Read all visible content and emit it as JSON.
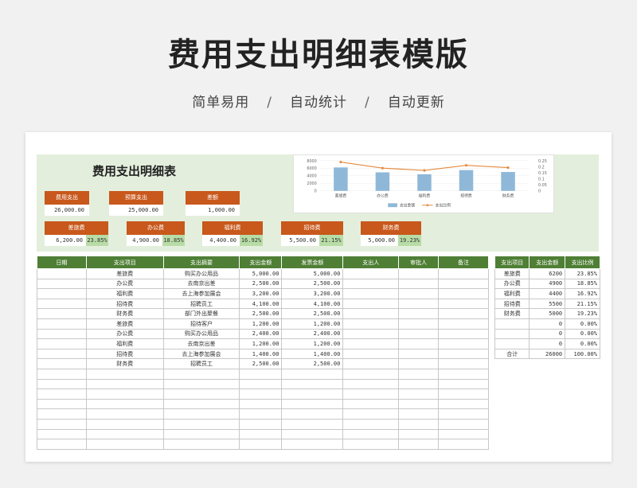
{
  "hero": {
    "title": "费用支出明细表模版",
    "subtitle_items": [
      "简单易用",
      "自动统计",
      "自动更新"
    ],
    "separator": "/"
  },
  "panel": {
    "title": "费用支出明细表",
    "kpis": [
      {
        "label": "费用支出",
        "value": "26,000.00"
      },
      {
        "label": "预算支出",
        "value": "25,000.00"
      },
      {
        "label": "差额",
        "value": "1,000.00"
      }
    ],
    "categories": [
      {
        "label": "差旅费",
        "value": "6,200.00",
        "pct": "23.85%"
      },
      {
        "label": "办公费",
        "value": "4,900.00",
        "pct": "18.85%"
      },
      {
        "label": "福利费",
        "value": "4,400.00",
        "pct": "16.92%"
      },
      {
        "label": "招待费",
        "value": "5,500.00",
        "pct": "21.15%"
      },
      {
        "label": "财务费",
        "value": "5,000.00",
        "pct": "19.23%"
      }
    ]
  },
  "chart_data": {
    "type": "bar",
    "categories": [
      "差旅费",
      "办公费",
      "福利费",
      "招待费",
      "财务费"
    ],
    "series": [
      {
        "name": "支出金额",
        "type": "bar",
        "values": [
          6200,
          4900,
          4400,
          5500,
          5000
        ],
        "axis": "left"
      },
      {
        "name": "支出比例",
        "type": "line",
        "values": [
          0.2385,
          0.1885,
          0.1692,
          0.2115,
          0.1923
        ],
        "axis": "right"
      }
    ],
    "y_ticks": [
      "8000",
      "6000",
      "4000",
      "2000",
      "0"
    ],
    "y2_ticks": [
      "0.25",
      "0.2",
      "0.15",
      "0.1",
      "0.05",
      "0"
    ],
    "ylim": [
      0,
      8000
    ],
    "y2lim": [
      0,
      0.25
    ],
    "legend_position": "bottom",
    "colors": {
      "bar": "#8fb8d8",
      "line": "#e58a3c"
    }
  },
  "main_table": {
    "headers": [
      "日期",
      "支出项目",
      "支出摘要",
      "支出金额",
      "发票金额",
      "支出人",
      "审批人",
      "备注"
    ],
    "rows": [
      [
        "",
        "差旅费",
        "购买办公用品",
        "5,000.00",
        "5,000.00",
        "",
        "",
        ""
      ],
      [
        "",
        "办公费",
        "去南京出差",
        "2,500.00",
        "2,500.00",
        "",
        "",
        ""
      ],
      [
        "",
        "福利费",
        "去上海参加展会",
        "3,200.00",
        "3,200.00",
        "",
        "",
        ""
      ],
      [
        "",
        "招待费",
        "招聘员工",
        "4,100.00",
        "4,100.00",
        "",
        "",
        ""
      ],
      [
        "",
        "财务费",
        "部门外出聚餐",
        "2,500.00",
        "2,500.00",
        "",
        "",
        ""
      ],
      [
        "",
        "差旅费",
        "招待客户",
        "1,200.00",
        "1,200.00",
        "",
        "",
        ""
      ],
      [
        "",
        "办公费",
        "购买办公用品",
        "2,400.00",
        "2,400.00",
        "",
        "",
        ""
      ],
      [
        "",
        "福利费",
        "去南京出差",
        "1,200.00",
        "1,200.00",
        "",
        "",
        ""
      ],
      [
        "",
        "招待费",
        "去上海参加展会",
        "1,400.00",
        "1,400.00",
        "",
        "",
        ""
      ],
      [
        "",
        "财务费",
        "招聘员工",
        "2,500.00",
        "2,500.00",
        "",
        "",
        ""
      ],
      [
        "",
        "",
        "",
        "",
        "",
        "",
        "",
        ""
      ],
      [
        "",
        "",
        "",
        "",
        "",
        "",
        "",
        ""
      ],
      [
        "",
        "",
        "",
        "",
        "",
        "",
        "",
        ""
      ],
      [
        "",
        "",
        "",
        "",
        "",
        "",
        "",
        ""
      ],
      [
        "",
        "",
        "",
        "",
        "",
        "",
        "",
        ""
      ],
      [
        "",
        "",
        "",
        "",
        "",
        "",
        "",
        ""
      ],
      [
        "",
        "",
        "",
        "",
        "",
        "",
        "",
        ""
      ],
      [
        "",
        "",
        "",
        "",
        "",
        "",
        "",
        ""
      ]
    ]
  },
  "summary_table": {
    "headers": [
      "支出项目",
      "支出金额",
      "支出比例"
    ],
    "rows": [
      [
        "差旅费",
        "6200",
        "23.85%"
      ],
      [
        "办公费",
        "4900",
        "18.85%"
      ],
      [
        "福利费",
        "4400",
        "16.92%"
      ],
      [
        "招待费",
        "5500",
        "21.15%"
      ],
      [
        "财务费",
        "5000",
        "19.23%"
      ],
      [
        "",
        "0",
        "0.00%"
      ],
      [
        "",
        "0",
        "0.00%"
      ],
      [
        "",
        "0",
        "0.00%"
      ],
      [
        "合计",
        "26000",
        "100.00%"
      ]
    ]
  }
}
